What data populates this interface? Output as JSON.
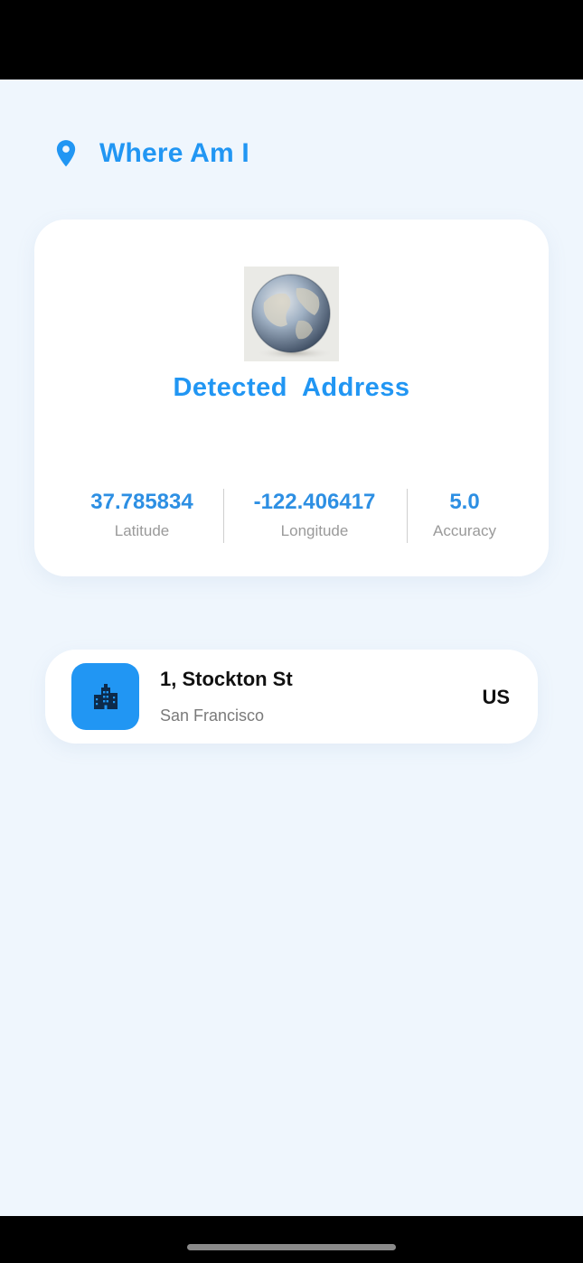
{
  "header": {
    "title": "Where Am I",
    "icon": "location-pin-icon"
  },
  "location_card": {
    "image": "globe-image",
    "title": "Detected  Address",
    "stats": [
      {
        "value": "37.785834",
        "label": "Latitude"
      },
      {
        "value": "-122.406417",
        "label": "Longitude"
      },
      {
        "value": "5.0",
        "label": "Accuracy"
      }
    ]
  },
  "address": {
    "icon": "city-buildings-icon",
    "street": "1, Stockton St",
    "city": "San Francisco",
    "country": "US"
  },
  "colors": {
    "accent": "#2196f3",
    "background": "#eff6fd",
    "card": "#ffffff"
  }
}
